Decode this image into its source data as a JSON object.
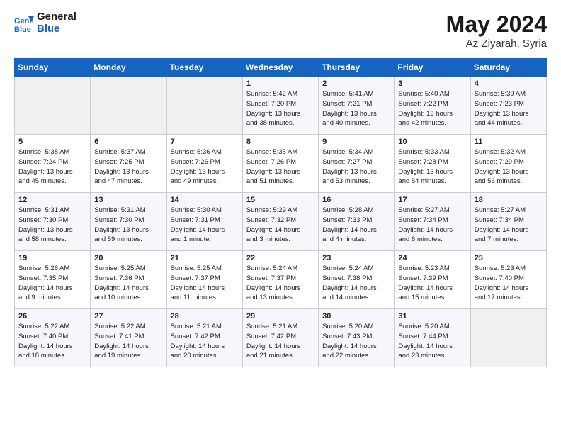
{
  "logo": {
    "line1": "General",
    "line2": "Blue"
  },
  "title": "May 2024",
  "location": "Az Ziyarah, Syria",
  "days_of_week": [
    "Sunday",
    "Monday",
    "Tuesday",
    "Wednesday",
    "Thursday",
    "Friday",
    "Saturday"
  ],
  "weeks": [
    [
      {
        "num": "",
        "info": ""
      },
      {
        "num": "",
        "info": ""
      },
      {
        "num": "",
        "info": ""
      },
      {
        "num": "1",
        "info": "Sunrise: 5:42 AM\nSunset: 7:20 PM\nDaylight: 13 hours\nand 38 minutes."
      },
      {
        "num": "2",
        "info": "Sunrise: 5:41 AM\nSunset: 7:21 PM\nDaylight: 13 hours\nand 40 minutes."
      },
      {
        "num": "3",
        "info": "Sunrise: 5:40 AM\nSunset: 7:22 PM\nDaylight: 13 hours\nand 42 minutes."
      },
      {
        "num": "4",
        "info": "Sunrise: 5:39 AM\nSunset: 7:23 PM\nDaylight: 13 hours\nand 44 minutes."
      }
    ],
    [
      {
        "num": "5",
        "info": "Sunrise: 5:38 AM\nSunset: 7:24 PM\nDaylight: 13 hours\nand 45 minutes."
      },
      {
        "num": "6",
        "info": "Sunrise: 5:37 AM\nSunset: 7:25 PM\nDaylight: 13 hours\nand 47 minutes."
      },
      {
        "num": "7",
        "info": "Sunrise: 5:36 AM\nSunset: 7:26 PM\nDaylight: 13 hours\nand 49 minutes."
      },
      {
        "num": "8",
        "info": "Sunrise: 5:35 AM\nSunset: 7:26 PM\nDaylight: 13 hours\nand 51 minutes."
      },
      {
        "num": "9",
        "info": "Sunrise: 5:34 AM\nSunset: 7:27 PM\nDaylight: 13 hours\nand 53 minutes."
      },
      {
        "num": "10",
        "info": "Sunrise: 5:33 AM\nSunset: 7:28 PM\nDaylight: 13 hours\nand 54 minutes."
      },
      {
        "num": "11",
        "info": "Sunrise: 5:32 AM\nSunset: 7:29 PM\nDaylight: 13 hours\nand 56 minutes."
      }
    ],
    [
      {
        "num": "12",
        "info": "Sunrise: 5:31 AM\nSunset: 7:30 PM\nDaylight: 13 hours\nand 58 minutes."
      },
      {
        "num": "13",
        "info": "Sunrise: 5:31 AM\nSunset: 7:30 PM\nDaylight: 13 hours\nand 59 minutes."
      },
      {
        "num": "14",
        "info": "Sunrise: 5:30 AM\nSunset: 7:31 PM\nDaylight: 14 hours\nand 1 minute."
      },
      {
        "num": "15",
        "info": "Sunrise: 5:29 AM\nSunset: 7:32 PM\nDaylight: 14 hours\nand 3 minutes."
      },
      {
        "num": "16",
        "info": "Sunrise: 5:28 AM\nSunset: 7:33 PM\nDaylight: 14 hours\nand 4 minutes."
      },
      {
        "num": "17",
        "info": "Sunrise: 5:27 AM\nSunset: 7:34 PM\nDaylight: 14 hours\nand 6 minutes."
      },
      {
        "num": "18",
        "info": "Sunrise: 5:27 AM\nSunset: 7:34 PM\nDaylight: 14 hours\nand 7 minutes."
      }
    ],
    [
      {
        "num": "19",
        "info": "Sunrise: 5:26 AM\nSunset: 7:35 PM\nDaylight: 14 hours\nand 9 minutes."
      },
      {
        "num": "20",
        "info": "Sunrise: 5:25 AM\nSunset: 7:36 PM\nDaylight: 14 hours\nand 10 minutes."
      },
      {
        "num": "21",
        "info": "Sunrise: 5:25 AM\nSunset: 7:37 PM\nDaylight: 14 hours\nand 11 minutes."
      },
      {
        "num": "22",
        "info": "Sunrise: 5:24 AM\nSunset: 7:37 PM\nDaylight: 14 hours\nand 13 minutes."
      },
      {
        "num": "23",
        "info": "Sunrise: 5:24 AM\nSunset: 7:38 PM\nDaylight: 14 hours\nand 14 minutes."
      },
      {
        "num": "24",
        "info": "Sunrise: 5:23 AM\nSunset: 7:39 PM\nDaylight: 14 hours\nand 15 minutes."
      },
      {
        "num": "25",
        "info": "Sunrise: 5:23 AM\nSunset: 7:40 PM\nDaylight: 14 hours\nand 17 minutes."
      }
    ],
    [
      {
        "num": "26",
        "info": "Sunrise: 5:22 AM\nSunset: 7:40 PM\nDaylight: 14 hours\nand 18 minutes."
      },
      {
        "num": "27",
        "info": "Sunrise: 5:22 AM\nSunset: 7:41 PM\nDaylight: 14 hours\nand 19 minutes."
      },
      {
        "num": "28",
        "info": "Sunrise: 5:21 AM\nSunset: 7:42 PM\nDaylight: 14 hours\nand 20 minutes."
      },
      {
        "num": "29",
        "info": "Sunrise: 5:21 AM\nSunset: 7:42 PM\nDaylight: 14 hours\nand 21 minutes."
      },
      {
        "num": "30",
        "info": "Sunrise: 5:20 AM\nSunset: 7:43 PM\nDaylight: 14 hours\nand 22 minutes."
      },
      {
        "num": "31",
        "info": "Sunrise: 5:20 AM\nSunset: 7:44 PM\nDaylight: 14 hours\nand 23 minutes."
      },
      {
        "num": "",
        "info": ""
      }
    ]
  ]
}
